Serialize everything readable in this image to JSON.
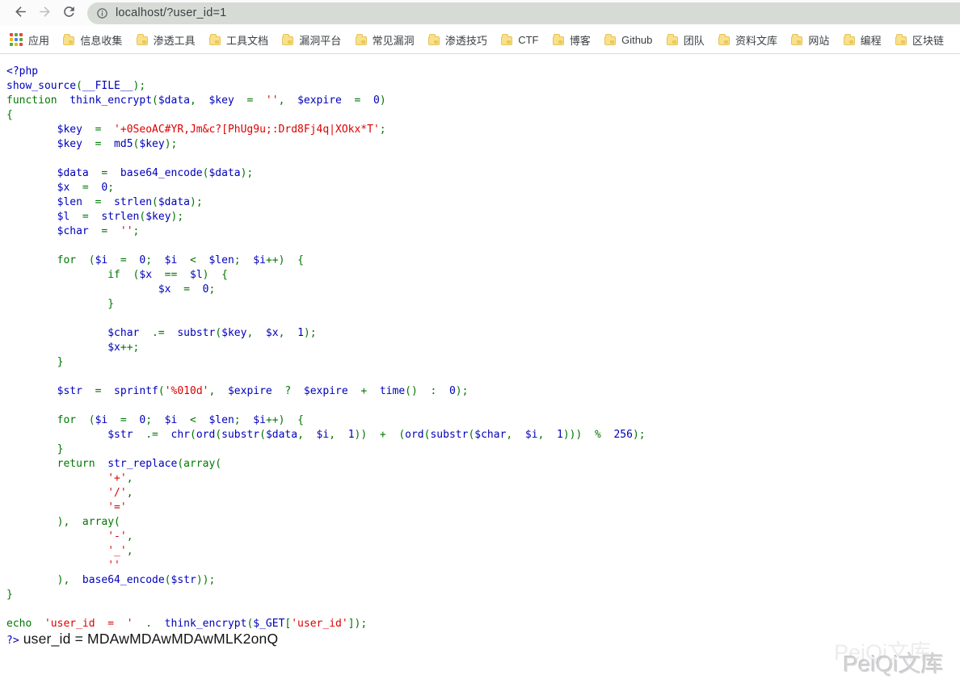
{
  "browser": {
    "url": "localhost/?user_id=1"
  },
  "bookmarks": {
    "apps_label": "应用",
    "apps_icon_colors": [
      "#e8453c",
      "#53a93f",
      "#e8453c",
      "#f4b400",
      "#4285f4",
      "#53a93f",
      "#53a93f",
      "#f4b400",
      "#e8453c"
    ],
    "items": [
      "信息收集",
      "渗透工具",
      "工具文档",
      "漏洞平台",
      "常见漏洞",
      "渗透技巧",
      "CTF",
      "博客",
      "Github",
      "团队",
      "资料文库",
      "网站",
      "编程",
      "区块链"
    ]
  },
  "code": {
    "syntax_colors": {
      "keyword": "#007700",
      "default": "#0000BB",
      "string": "#DD0000",
      "output_text": "#141414"
    },
    "lines": [
      [
        [
          "d",
          "<?php"
        ]
      ],
      [
        [
          "d",
          "show_source"
        ],
        [
          "k",
          "("
        ],
        [
          "d",
          "__FILE__"
        ],
        [
          "k",
          ");"
        ]
      ],
      [
        [
          "k",
          "function"
        ],
        [
          "d",
          "  think_encrypt"
        ],
        [
          "k",
          "("
        ],
        [
          "d",
          "$data"
        ],
        [
          "k",
          ","
        ],
        [
          "d",
          "  $key"
        ],
        [
          "k",
          "  ="
        ],
        [
          "s",
          "  ''"
        ],
        [
          "k",
          ","
        ],
        [
          "d",
          "  $expire"
        ],
        [
          "k",
          "  ="
        ],
        [
          "d",
          "  0"
        ],
        [
          "k",
          ")"
        ]
      ],
      [
        [
          "k",
          "{"
        ]
      ],
      [
        [
          "d",
          "        $key"
        ],
        [
          "k",
          "  ="
        ],
        [
          "s",
          "  '+0SeoAC#YR,Jm&c?[PhUg9u;:Drd8Fj4q|XOkx*T'"
        ],
        [
          "k",
          ";"
        ]
      ],
      [
        [
          "d",
          "        $key"
        ],
        [
          "k",
          "  ="
        ],
        [
          "d",
          "  md5"
        ],
        [
          "k",
          "("
        ],
        [
          "d",
          "$key"
        ],
        [
          "k",
          ");"
        ]
      ],
      [],
      [
        [
          "d",
          "        $data"
        ],
        [
          "k",
          "  ="
        ],
        [
          "d",
          "  base64_encode"
        ],
        [
          "k",
          "("
        ],
        [
          "d",
          "$data"
        ],
        [
          "k",
          ");"
        ]
      ],
      [
        [
          "d",
          "        $x"
        ],
        [
          "k",
          "  ="
        ],
        [
          "d",
          "  0"
        ],
        [
          "k",
          ";"
        ]
      ],
      [
        [
          "d",
          "        $len"
        ],
        [
          "k",
          "  ="
        ],
        [
          "d",
          "  strlen"
        ],
        [
          "k",
          "("
        ],
        [
          "d",
          "$data"
        ],
        [
          "k",
          ");"
        ]
      ],
      [
        [
          "d",
          "        $l"
        ],
        [
          "k",
          "  ="
        ],
        [
          "d",
          "  strlen"
        ],
        [
          "k",
          "("
        ],
        [
          "d",
          "$key"
        ],
        [
          "k",
          ");"
        ]
      ],
      [
        [
          "d",
          "        $char"
        ],
        [
          "k",
          "  ="
        ],
        [
          "s",
          "  ''"
        ],
        [
          "k",
          ";"
        ]
      ],
      [],
      [
        [
          "k",
          "        for  ("
        ],
        [
          "d",
          "$i"
        ],
        [
          "k",
          "  ="
        ],
        [
          "d",
          "  0"
        ],
        [
          "k",
          ";"
        ],
        [
          "d",
          "  $i"
        ],
        [
          "k",
          "  <"
        ],
        [
          "d",
          "  $len"
        ],
        [
          "k",
          ";"
        ],
        [
          "d",
          "  $i"
        ],
        [
          "k",
          "++)  {"
        ]
      ],
      [
        [
          "k",
          "                if  ("
        ],
        [
          "d",
          "$x"
        ],
        [
          "k",
          "  =="
        ],
        [
          "d",
          "  $l"
        ],
        [
          "k",
          ")  {"
        ]
      ],
      [
        [
          "d",
          "                        $x"
        ],
        [
          "k",
          "  ="
        ],
        [
          "d",
          "  0"
        ],
        [
          "k",
          ";"
        ]
      ],
      [
        [
          "k",
          "                }"
        ]
      ],
      [],
      [
        [
          "d",
          "                $char"
        ],
        [
          "k",
          "  .="
        ],
        [
          "d",
          "  substr"
        ],
        [
          "k",
          "("
        ],
        [
          "d",
          "$key"
        ],
        [
          "k",
          ","
        ],
        [
          "d",
          "  $x"
        ],
        [
          "k",
          ","
        ],
        [
          "d",
          "  1"
        ],
        [
          "k",
          ");"
        ]
      ],
      [
        [
          "d",
          "                $x"
        ],
        [
          "k",
          "++;"
        ]
      ],
      [
        [
          "k",
          "        }"
        ]
      ],
      [],
      [
        [
          "d",
          "        $str"
        ],
        [
          "k",
          "  ="
        ],
        [
          "d",
          "  sprintf"
        ],
        [
          "k",
          "("
        ],
        [
          "s",
          "'%010d'"
        ],
        [
          "k",
          ","
        ],
        [
          "d",
          "  $expire"
        ],
        [
          "k",
          "  ?"
        ],
        [
          "d",
          "  $expire"
        ],
        [
          "k",
          "  +"
        ],
        [
          "d",
          "  time"
        ],
        [
          "k",
          "()  :"
        ],
        [
          "d",
          "  0"
        ],
        [
          "k",
          ");"
        ]
      ],
      [],
      [
        [
          "k",
          "        for  ("
        ],
        [
          "d",
          "$i"
        ],
        [
          "k",
          "  ="
        ],
        [
          "d",
          "  0"
        ],
        [
          "k",
          ";"
        ],
        [
          "d",
          "  $i"
        ],
        [
          "k",
          "  <"
        ],
        [
          "d",
          "  $len"
        ],
        [
          "k",
          ";"
        ],
        [
          "d",
          "  $i"
        ],
        [
          "k",
          "++)  {"
        ]
      ],
      [
        [
          "d",
          "                $str"
        ],
        [
          "k",
          "  .="
        ],
        [
          "d",
          "  chr"
        ],
        [
          "k",
          "("
        ],
        [
          "d",
          "ord"
        ],
        [
          "k",
          "("
        ],
        [
          "d",
          "substr"
        ],
        [
          "k",
          "("
        ],
        [
          "d",
          "$data"
        ],
        [
          "k",
          ","
        ],
        [
          "d",
          "  $i"
        ],
        [
          "k",
          ","
        ],
        [
          "d",
          "  1"
        ],
        [
          "k",
          "))  +  ("
        ],
        [
          "d",
          "ord"
        ],
        [
          "k",
          "("
        ],
        [
          "d",
          "substr"
        ],
        [
          "k",
          "("
        ],
        [
          "d",
          "$char"
        ],
        [
          "k",
          ","
        ],
        [
          "d",
          "  $i"
        ],
        [
          "k",
          ","
        ],
        [
          "d",
          "  1"
        ],
        [
          "k",
          ")))  %"
        ],
        [
          "d",
          "  256"
        ],
        [
          "k",
          ");"
        ]
      ],
      [
        [
          "k",
          "        }"
        ]
      ],
      [
        [
          "k",
          "        return"
        ],
        [
          "d",
          "  str_replace"
        ],
        [
          "k",
          "(array("
        ]
      ],
      [
        [
          "s",
          "                '+'"
        ],
        [
          "k",
          ","
        ]
      ],
      [
        [
          "s",
          "                '/'"
        ],
        [
          "k",
          ","
        ]
      ],
      [
        [
          "s",
          "                '='"
        ]
      ],
      [
        [
          "k",
          "        ),  array("
        ]
      ],
      [
        [
          "s",
          "                '-'"
        ],
        [
          "k",
          ","
        ]
      ],
      [
        [
          "s",
          "                '_'"
        ],
        [
          "k",
          ","
        ]
      ],
      [
        [
          "s",
          "                ''"
        ]
      ],
      [
        [
          "k",
          "        ),  "
        ],
        [
          "d",
          "base64_encode"
        ],
        [
          "k",
          "("
        ],
        [
          "d",
          "$str"
        ],
        [
          "k",
          "));"
        ]
      ],
      [
        [
          "k",
          "}"
        ]
      ],
      [],
      [
        [
          "k",
          "echo"
        ],
        [
          "s",
          "  'user_id  =  '"
        ],
        [
          "k",
          "  ."
        ],
        [
          "d",
          "  think_encrypt"
        ],
        [
          "k",
          "("
        ],
        [
          "d",
          "$_GET"
        ],
        [
          "k",
          "["
        ],
        [
          "s",
          "'user_id'"
        ],
        [
          "k",
          "]);"
        ]
      ],
      [
        [
          "d",
          "?>"
        ],
        [
          "p",
          " user_id = MDAwMDAwMDAwMLK2onQ"
        ]
      ]
    ]
  },
  "watermark": {
    "text": "PeiQi文库"
  }
}
